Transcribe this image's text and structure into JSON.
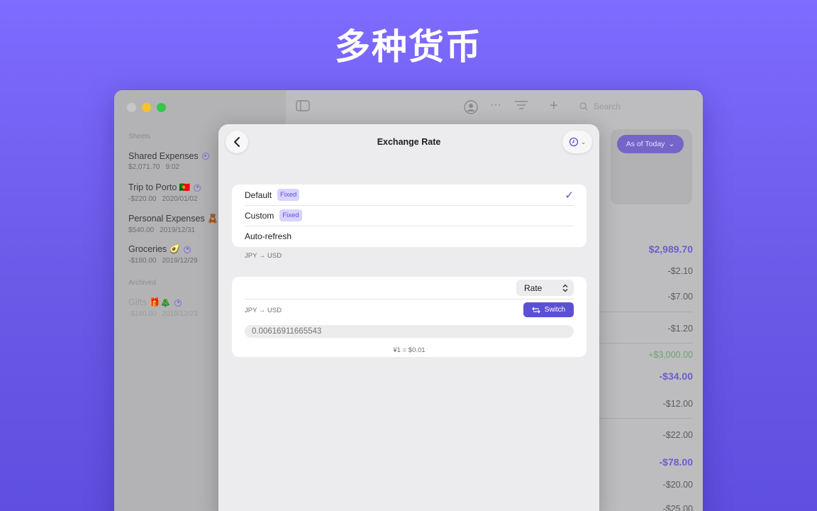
{
  "hero": {
    "title": "多种货币"
  },
  "sidebar": {
    "section_sheets": "Sheets",
    "section_archived": "Archived",
    "items": [
      {
        "name": "Shared Expenses",
        "shared": true,
        "amount": "$2,071.70",
        "date": "9:02"
      },
      {
        "name": "Trip to Porto 🇵🇹",
        "shared": true,
        "amount": "-$220.00",
        "date": "2020/01/02"
      },
      {
        "name": "Personal Expenses 🧸",
        "shared": false,
        "amount": "$540.00",
        "date": "2019/12/31"
      },
      {
        "name": "Groceries 🥑",
        "shared": true,
        "amount": "-$180.00",
        "date": "2019/12/29"
      }
    ],
    "archived": [
      {
        "name": "Gifts 🎁🎄",
        "shared": true,
        "amount": "-$160.00",
        "date": "2019/12/23"
      }
    ]
  },
  "toolbar": {
    "search_placeholder": "Search",
    "icons": [
      "sidebar-toggle-icon",
      "share-icon",
      "more-icon",
      "filter-icon",
      "plus-icon",
      "search-icon"
    ]
  },
  "right_panel": {
    "as_of_label": "As of Today",
    "amounts": [
      {
        "text": "$2,989.70",
        "style": "big"
      },
      {
        "text": "-$2.10",
        "style": "normal"
      },
      {
        "text": "-$7.00",
        "style": "normal"
      },
      {
        "text": "-$1.20",
        "style": "normal"
      },
      {
        "text": "+$3,000.00",
        "style": "pos"
      },
      {
        "text": "-$34.00",
        "style": "big"
      },
      {
        "text": "-$12.00",
        "style": "normal"
      },
      {
        "text": "-$22.00",
        "style": "normal"
      },
      {
        "text": "-$78.00",
        "style": "big"
      },
      {
        "text": "-$20.00",
        "style": "normal"
      },
      {
        "text": "-$25.00",
        "style": "normal"
      }
    ]
  },
  "modal": {
    "title": "Exchange Rate",
    "options": [
      {
        "label": "Default",
        "badge": "Fixed",
        "selected": true
      },
      {
        "label": "Custom",
        "badge": "Fixed",
        "selected": false
      },
      {
        "label": "Auto-refresh",
        "badge": "",
        "selected": false
      }
    ],
    "options_caption": "JPY → USD",
    "rate_select": "Rate",
    "pair_label": "JPY → USD",
    "switch_label": "Switch",
    "rate_placeholder": "0.00616911665543",
    "equivalence": "¥1 = $0.01",
    "accent_color": "#5b4fd4"
  }
}
